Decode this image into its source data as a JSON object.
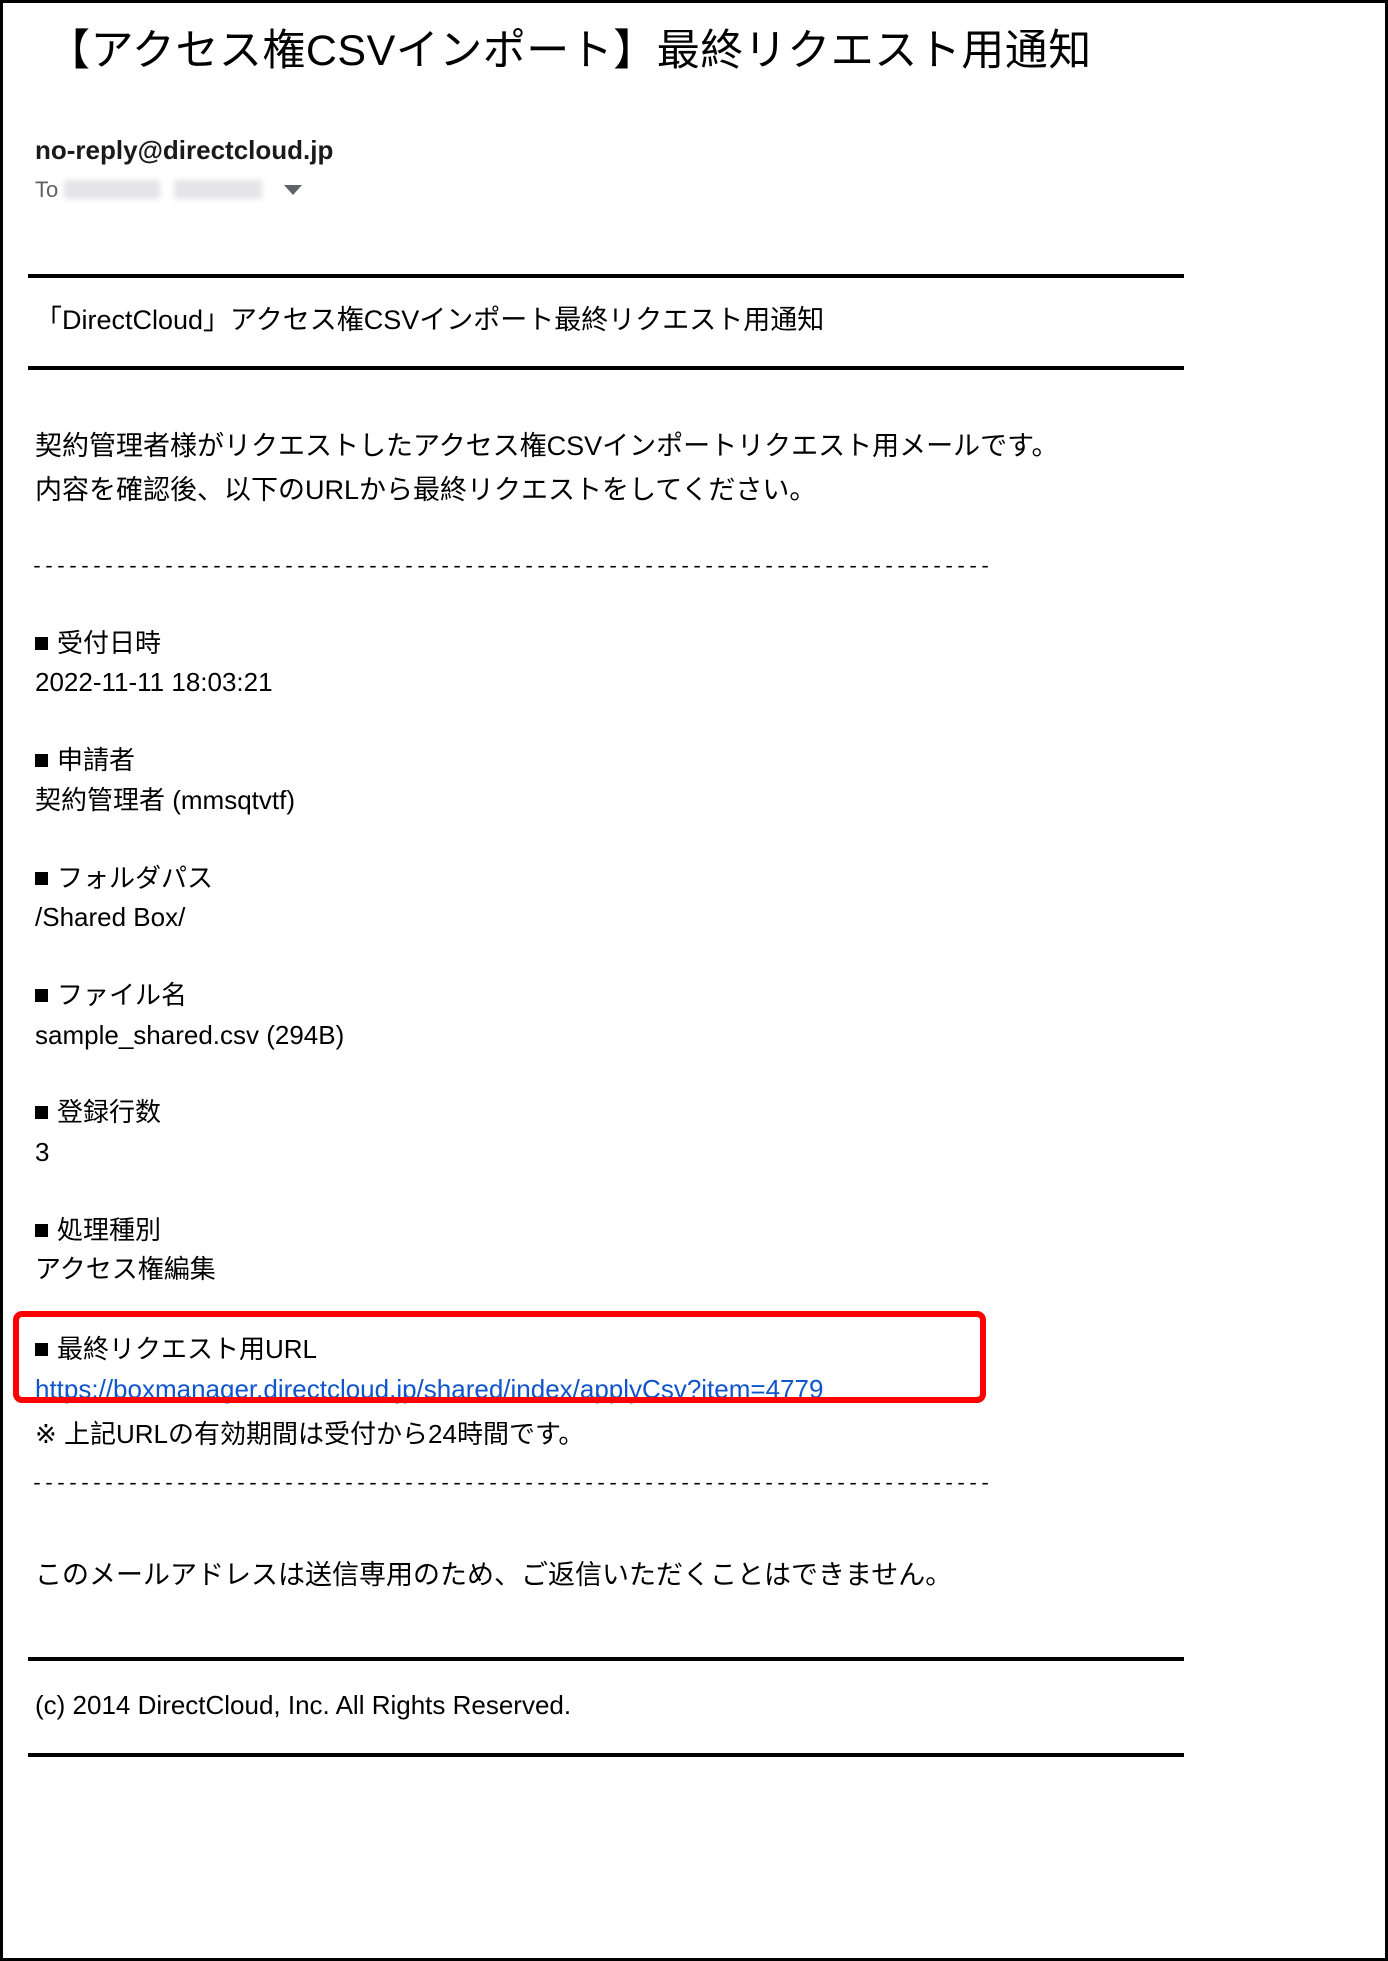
{
  "email": {
    "subject": "【アクセス権CSVインポート】最終リクエスト用通知",
    "sender": "no-reply@directcloud.jp",
    "to_label": "To",
    "recipient_redacted": "",
    "recipient_caret_icon": "chevron-down-icon"
  },
  "banner": {
    "title": "「DirectCloud」アクセス権CSVインポート最終リクエスト用通知"
  },
  "intro": {
    "line1": "契約管理者様がリクエストしたアクセス権CSVインポートリクエスト用メールです。",
    "line2": "内容を確認後、以下のURLから最終リクエストをしてください。"
  },
  "separator": {
    "dashes": "--------------------------------------------------------------------------------"
  },
  "fields": [
    {
      "label": "受付日時",
      "value": "2022-11-11 18:03:21"
    },
    {
      "label": "申請者",
      "value": "契約管理者 (mmsqtvtf)"
    },
    {
      "label": "フォルダパス",
      "value": "/Shared Box/"
    },
    {
      "label": "ファイル名",
      "value": "sample_shared.csv (294B)"
    },
    {
      "label": "登録行数",
      "value": "3"
    },
    {
      "label": "処理種別",
      "value": "アクセス権編集"
    }
  ],
  "url_section": {
    "label": "最終リクエスト用URL",
    "link_text": "https://boxmanager.directcloud.jp/shared/index/applyCsv?item=4779",
    "note": "※ 上記URLの有効期間は受付から24時間です。",
    "highlight_color": "#ff0000",
    "link_color": "#1155cc"
  },
  "closing": {
    "text": "このメールアドレスは送信専用のため、ご返信いただくことはできません。"
  },
  "footer": {
    "copyright": "(c) 2014 DirectCloud, Inc. All Rights Reserved."
  }
}
